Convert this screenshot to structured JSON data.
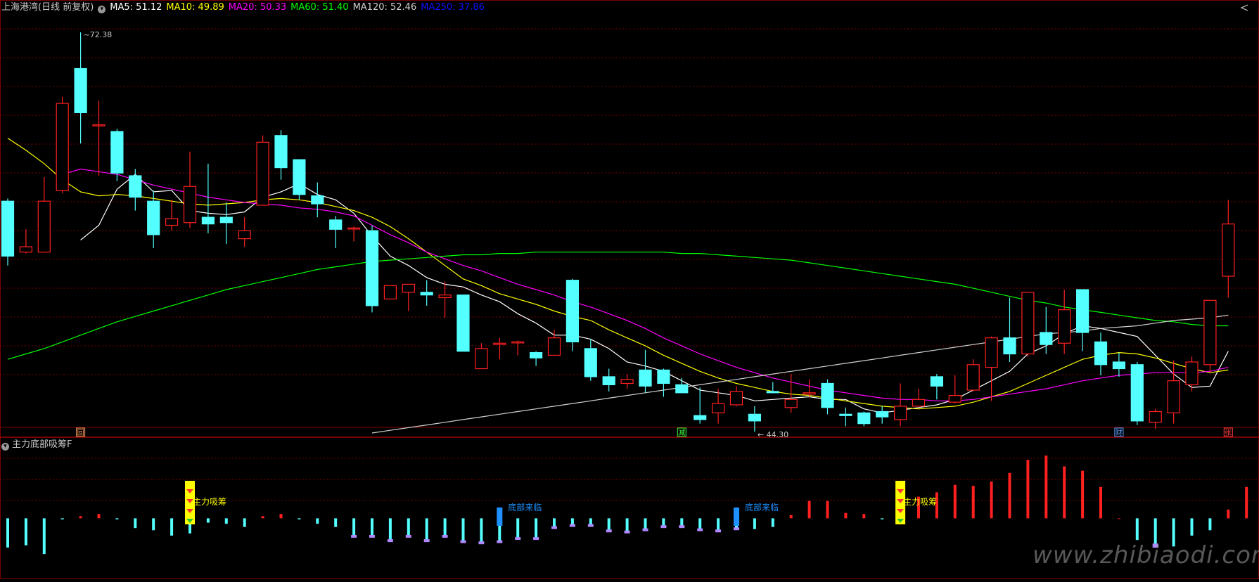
{
  "header": {
    "title": "上海港湾(日线 前复权)",
    "ma": [
      {
        "label": "MA5: 51.12",
        "color": "#ffffff"
      },
      {
        "label": "MA10: 49.89",
        "color": "#ffff00"
      },
      {
        "label": "MA20: 50.33",
        "color": "#ff00ff"
      },
      {
        "label": "MA60: 51.40",
        "color": "#00ff00"
      },
      {
        "label": "MA120: 52.46",
        "color": "#d0d0d0"
      },
      {
        "label": "MA250: 37.86",
        "color": "#1010ff"
      }
    ]
  },
  "indicator_title": "主力底部吸筹F",
  "watermark": "www.zhibiaodi.com",
  "colors": {
    "up": "#ff2020",
    "down": "#54ffff",
    "grid": "#7a0000",
    "signal_blue": "#1e90ff",
    "signal_yellow": "#ffff00",
    "purple": "#b088ff"
  },
  "chart_data": [
    {
      "type": "candlestick",
      "title": "上海港湾(日线 前复权)",
      "ylim": [
        42.5,
        74.5
      ],
      "high_label": "72.38",
      "low_label": "44.30",
      "markers": [
        {
          "index": 4,
          "text": "回",
          "color": "#ffa060"
        },
        {
          "index": 37,
          "text": "减",
          "color": "#40ff40"
        },
        {
          "index": 61,
          "text": "财",
          "color": "#5aa0ff"
        },
        {
          "index": 67,
          "text": "张",
          "color": "#ff4040"
        }
      ],
      "ohlc": [
        [
          59.8,
          55.7,
          60.0,
          55.0
        ],
        [
          56.0,
          56.4,
          57.7,
          55.9
        ],
        [
          56.0,
          59.8,
          61.6,
          56.0
        ],
        [
          60.6,
          67.1,
          67.6,
          60.4
        ],
        [
          69.7,
          66.4,
          72.4,
          64.1
        ],
        [
          65.5,
          65.5,
          67.3,
          61.7
        ],
        [
          65.0,
          61.9,
          65.2,
          61.3
        ],
        [
          61.7,
          60.1,
          62.2,
          59.1
        ],
        [
          59.8,
          57.3,
          60.6,
          56.3
        ],
        [
          58.0,
          58.5,
          59.9,
          57.6
        ],
        [
          58.2,
          60.9,
          63.5,
          57.8
        ],
        [
          58.6,
          58.1,
          62.6,
          57.4
        ],
        [
          58.6,
          58.2,
          59.7,
          56.6
        ],
        [
          57.0,
          57.6,
          58.6,
          56.4
        ],
        [
          59.5,
          64.2,
          64.7,
          59.5
        ],
        [
          64.7,
          62.3,
          65.1,
          61.4
        ],
        [
          62.9,
          60.3,
          62.9,
          59.9
        ],
        [
          60.2,
          59.6,
          61.2,
          58.6
        ],
        [
          58.4,
          57.7,
          58.7,
          56.3
        ],
        [
          57.8,
          57.8,
          57.9,
          56.8
        ],
        [
          57.6,
          52.0,
          58.0,
          51.5
        ],
        [
          52.5,
          53.5,
          53.5,
          52.7
        ],
        [
          53.0,
          53.6,
          53.6,
          51.6
        ],
        [
          53.0,
          52.8,
          53.9,
          52.0
        ],
        [
          52.6,
          52.8,
          53.8,
          51.1
        ],
        [
          52.8,
          48.6,
          52.8,
          48.6
        ],
        [
          47.3,
          48.8,
          49.2,
          47.3
        ],
        [
          49.1,
          49.2,
          49.6,
          48.0
        ],
        [
          49.3,
          49.3,
          49.4,
          48.3
        ],
        [
          48.5,
          48.1,
          48.6,
          47.5
        ],
        [
          48.3,
          49.6,
          50.2,
          48.3
        ],
        [
          53.9,
          49.3,
          54.0,
          48.6
        ],
        [
          48.8,
          46.7,
          49.5,
          46.4
        ],
        [
          46.7,
          46.1,
          47.3,
          45.6
        ],
        [
          46.2,
          46.5,
          46.9,
          45.8
        ],
        [
          47.2,
          46.0,
          48.7,
          45.5
        ],
        [
          47.2,
          46.2,
          47.3,
          45.2
        ],
        [
          46.1,
          45.5,
          46.6,
          45.5
        ],
        [
          43.8,
          43.5,
          45.9,
          43.2
        ],
        [
          44.0,
          44.7,
          45.8,
          43.2
        ],
        [
          44.6,
          45.6,
          46.0,
          44.5
        ],
        [
          43.9,
          43.4,
          44.5,
          42.6
        ],
        [
          45.6,
          45.5,
          46.3,
          45.6
        ],
        [
          44.4,
          45.0,
          46.9,
          44.0
        ],
        [
          45.4,
          45.5,
          46.5,
          45.2
        ],
        [
          46.2,
          44.4,
          46.5,
          43.9
        ],
        [
          43.9,
          43.8,
          44.4,
          43.0
        ],
        [
          44.0,
          43.2,
          44.1,
          43.0
        ],
        [
          44.1,
          43.7,
          44.5,
          43.2
        ],
        [
          43.5,
          44.5,
          46.2,
          43.0
        ],
        [
          44.5,
          45.0,
          45.8,
          44.8
        ],
        [
          46.7,
          46.0,
          46.9,
          45.0
        ],
        [
          44.8,
          45.3,
          46.8,
          44.7
        ],
        [
          45.7,
          47.6,
          48.0,
          45.6
        ],
        [
          47.4,
          49.6,
          49.7,
          44.9
        ],
        [
          49.6,
          48.4,
          52.6,
          47.8
        ],
        [
          48.4,
          53.0,
          53.0,
          48.2
        ],
        [
          50.0,
          49.1,
          51.9,
          48.4
        ],
        [
          49.2,
          51.7,
          53.2,
          48.4
        ],
        [
          53.2,
          50.0,
          53.2,
          48.6
        ],
        [
          49.3,
          47.6,
          50.0,
          46.8
        ],
        [
          47.8,
          47.3,
          48.5,
          46.7
        ],
        [
          47.6,
          43.4,
          47.8,
          43.1
        ],
        [
          43.3,
          44.1,
          44.3,
          42.8
        ],
        [
          44.0,
          46.4,
          47.9,
          43.2
        ],
        [
          46.1,
          47.8,
          48.2,
          45.6
        ],
        [
          47.6,
          52.4,
          52.4,
          47.0
        ],
        [
          54.2,
          58.1,
          59.9,
          52.6
        ]
      ],
      "ma_series": [
        {
          "name": "MA5",
          "color": "#ffffff",
          "values": [
            null,
            null,
            null,
            null,
            56.9,
            58.0,
            60.7,
            61.8,
            60.5,
            60.6,
            59.1,
            58.9,
            58.8,
            59.0,
            60.1,
            60.5,
            61.1,
            60.3,
            59.9,
            58.9,
            57.2,
            55.7,
            55.0,
            54.1,
            53.6,
            53.4,
            52.8,
            52.3,
            51.4,
            50.7,
            49.8,
            49.8,
            49.5,
            48.8,
            47.8,
            47.5,
            47.1,
            46.4,
            45.7,
            45.5,
            45.3,
            44.9,
            45.0,
            45.1,
            45.2,
            45.0,
            45.0,
            44.3,
            44.0,
            44.2,
            44.4,
            44.6,
            45.0,
            45.7,
            46.4,
            47.1,
            48.4,
            49.0,
            49.9,
            50.5,
            50.3,
            50.0,
            49.7,
            48.3,
            46.9,
            45.9,
            46.0,
            48.6
          ]
        },
        {
          "name": "MA10",
          "color": "#ffff00",
          "values": [
            64.5,
            63.6,
            62.6,
            61.4,
            60.5,
            60.2,
            60.3,
            60.2,
            60.0,
            59.8,
            59.6,
            59.5,
            59.6,
            59.7,
            59.9,
            60.0,
            59.9,
            59.7,
            59.4,
            59.1,
            58.6,
            57.9,
            57.0,
            56.0,
            55.0,
            54.0,
            53.5,
            52.9,
            52.5,
            52.1,
            51.6,
            51.2,
            50.9,
            50.2,
            49.6,
            49.0,
            48.3,
            47.7,
            47.1,
            46.6,
            46.2,
            45.9,
            45.6,
            45.4,
            45.3,
            45.1,
            44.9,
            44.7,
            44.5,
            44.4,
            44.3,
            44.4,
            44.5,
            44.8,
            45.2,
            45.6,
            46.2,
            46.8,
            47.4,
            48.0,
            48.3,
            48.5,
            48.4,
            48.1,
            47.7,
            47.3,
            47.0,
            47.2
          ]
        },
        {
          "name": "MA20",
          "color": "#ff00ff",
          "values": [
            null,
            null,
            null,
            61.8,
            62.2,
            62.0,
            61.8,
            61.4,
            61.0,
            60.7,
            60.4,
            60.1,
            59.9,
            59.7,
            59.6,
            59.5,
            59.3,
            59.2,
            59.0,
            58.7,
            58.0,
            57.3,
            56.7,
            56.0,
            55.5,
            55.0,
            54.6,
            54.1,
            53.6,
            53.2,
            52.8,
            52.3,
            51.9,
            51.4,
            50.9,
            50.3,
            49.6,
            49.0,
            48.4,
            47.9,
            47.4,
            47.0,
            46.6,
            46.3,
            46.0,
            45.7,
            45.5,
            45.3,
            45.1,
            45.0,
            45.0,
            44.9,
            44.9,
            45.0,
            45.2,
            45.4,
            45.6,
            45.8,
            46.1,
            46.4,
            46.6,
            46.8,
            46.9,
            47.0,
            47.0,
            47.0,
            47.1,
            47.4
          ]
        },
        {
          "name": "MA60",
          "color": "#00ff00",
          "values": [
            48.0,
            48.4,
            48.8,
            49.3,
            49.8,
            50.3,
            50.8,
            51.2,
            51.6,
            52.0,
            52.4,
            52.8,
            53.2,
            53.5,
            53.8,
            54.1,
            54.4,
            54.7,
            54.9,
            55.1,
            55.3,
            55.4,
            55.5,
            55.6,
            55.7,
            55.8,
            55.8,
            55.9,
            55.9,
            56.0,
            56.0,
            56.0,
            56.0,
            56.0,
            56.0,
            56.0,
            56.0,
            55.9,
            55.9,
            55.8,
            55.7,
            55.6,
            55.5,
            55.4,
            55.2,
            55.0,
            54.8,
            54.6,
            54.4,
            54.2,
            54.0,
            53.8,
            53.6,
            53.3,
            53.0,
            52.7,
            52.4,
            52.2,
            51.9,
            51.7,
            51.5,
            51.3,
            51.1,
            50.9,
            50.8,
            50.6,
            50.5,
            50.5
          ]
        },
        {
          "name": "MA120",
          "color": "#d0d0d0",
          "values": [
            null,
            null,
            null,
            null,
            null,
            null,
            null,
            null,
            null,
            null,
            null,
            null,
            null,
            null,
            null,
            null,
            null,
            null,
            null,
            null,
            42.5,
            42.7,
            42.9,
            43.1,
            43.3,
            43.5,
            43.7,
            43.9,
            44.1,
            44.3,
            44.5,
            44.7,
            44.9,
            45.1,
            45.3,
            45.5,
            45.7,
            45.9,
            46.1,
            46.3,
            46.5,
            46.7,
            46.9,
            47.1,
            47.3,
            47.5,
            47.7,
            47.9,
            48.1,
            48.3,
            48.5,
            48.7,
            48.9,
            49.1,
            49.3,
            49.5,
            49.7,
            49.9,
            50.0,
            50.1,
            50.3,
            50.4,
            50.5,
            50.7,
            50.9,
            51.0,
            51.1,
            51.3
          ]
        }
      ]
    },
    {
      "type": "bar",
      "title": "主力底部吸筹F",
      "ylim": [
        -5.5,
        7.5
      ],
      "values": [
        -2.7,
        -2.5,
        -3.3,
        -0.1,
        0.2,
        0.4,
        -0.1,
        -0.9,
        -1.1,
        -1.6,
        -1.4,
        -0.4,
        -0.5,
        -0.8,
        0.2,
        0.4,
        -0.1,
        -0.5,
        -0.8,
        -1.6,
        -1.6,
        -2.0,
        -1.6,
        -2.0,
        -1.6,
        -2.1,
        -2.2,
        -2.1,
        -1.8,
        -1.8,
        -0.8,
        -0.6,
        -0.6,
        -1.1,
        -1.2,
        -1.0,
        -0.7,
        -0.7,
        -1.0,
        -1.1,
        -0.9,
        -1.0,
        -0.8,
        0.3,
        1.6,
        1.6,
        0.5,
        0.4,
        -0.1,
        0.3,
        2.0,
        2.4,
        3.1,
        3.0,
        3.4,
        4.2,
        5.4,
        5.8,
        4.8,
        4.4,
        2.9,
        0.0,
        -2.0,
        -2.4,
        -2.6,
        -1.6,
        -1.1,
        0.8,
        2.9
      ],
      "purple": [
        0,
        0,
        0,
        0,
        0,
        0,
        0,
        0,
        0,
        0,
        0,
        0,
        0,
        0,
        0,
        0,
        0,
        0,
        0,
        -0.6,
        -0.6,
        -0.6,
        -0.6,
        -0.6,
        -0.6,
        -0.6,
        -0.6,
        -0.6,
        -0.5,
        -0.4,
        -0.4,
        -0.4,
        -0.3,
        -0.4,
        -0.5,
        -0.3,
        -0.3,
        -0.4,
        -0.4,
        -0.4,
        -0.4,
        0,
        0,
        0,
        0,
        0,
        0,
        0,
        0,
        0,
        0,
        0,
        0,
        0,
        0,
        0,
        0,
        0,
        0,
        0,
        0,
        0,
        0,
        -1.0,
        0,
        0,
        0,
        0,
        0
      ],
      "signals": [
        {
          "index": 10,
          "kind": "yellow",
          "text": "主力吸筹"
        },
        {
          "index": 27,
          "kind": "blue",
          "text": "底部来临"
        },
        {
          "index": 40,
          "kind": "blue",
          "text": "底部来临"
        },
        {
          "index": 49,
          "kind": "yellow",
          "text": "主力吸筹"
        }
      ]
    }
  ]
}
